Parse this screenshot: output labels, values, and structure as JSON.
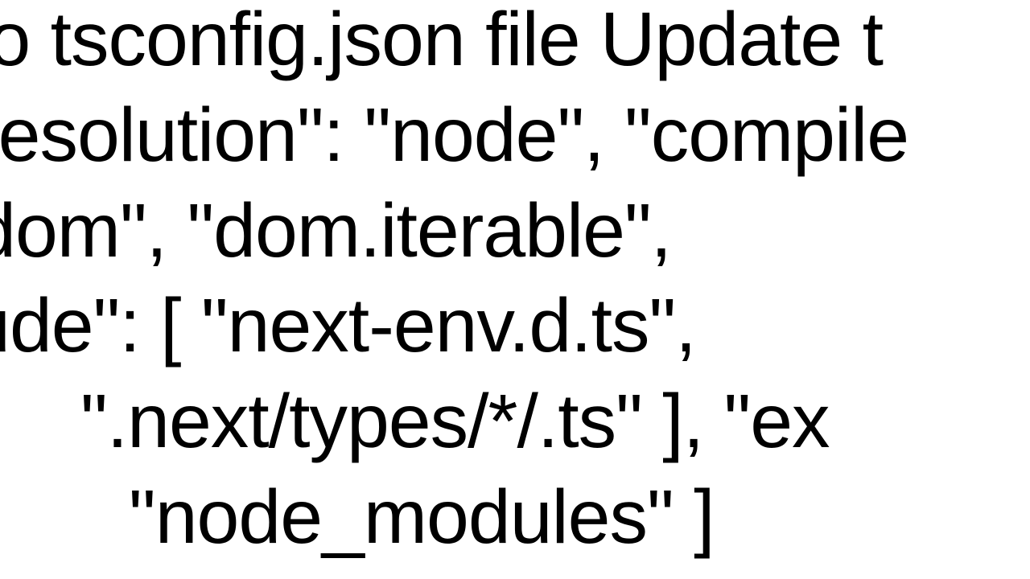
{
  "lines": {
    "l1": "to tsconfig.json file Update t",
    "l2": "Resolution\": \"node\", \"compile",
    "l3": "'dom\",     \"dom.iterable\",",
    "l4": "lude\": [    \"next-env.d.ts\",",
    "l5": "\".next/types/*/.ts\"   ],   \"ex",
    "l6": "\"node_modules\"   ]"
  }
}
